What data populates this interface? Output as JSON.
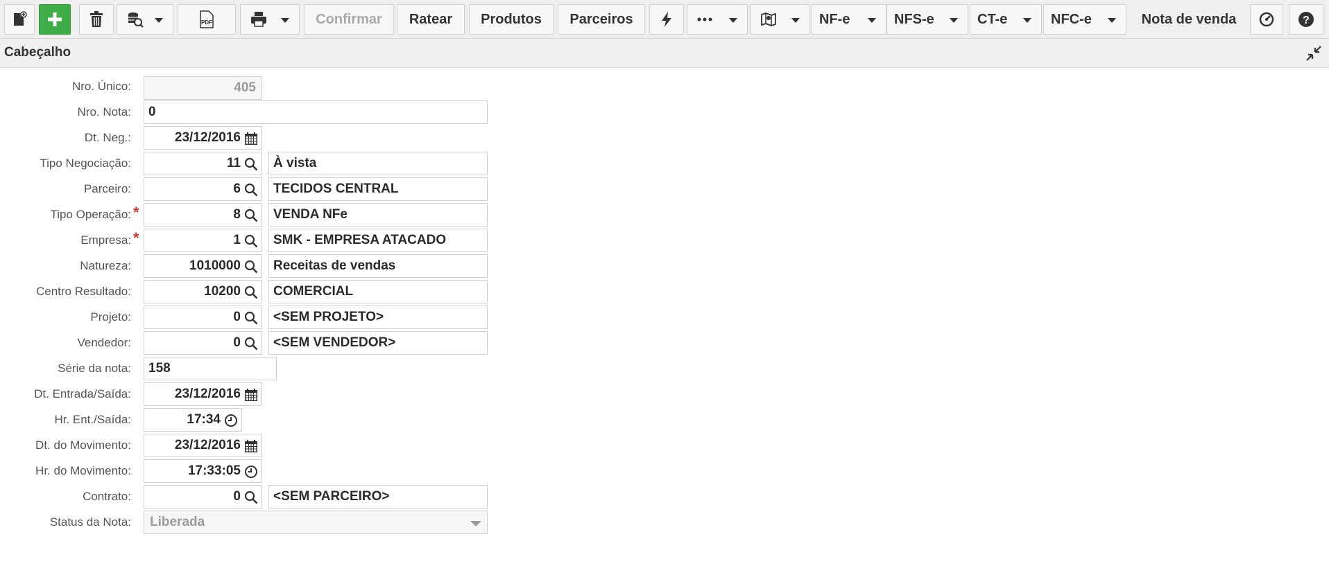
{
  "toolbar": {
    "confirmar_label": "Confirmar",
    "ratear_label": "Ratear",
    "produtos_label": "Produtos",
    "parceiros_label": "Parceiros",
    "nfe_label": "NF-e",
    "nfse_label": "NFS-e",
    "cte_label": "CT-e",
    "nfce_label": "NFC-e",
    "nota_de_venda_label": "Nota de venda",
    "pdf_icon_text": "PDF",
    "colors": {
      "green": "#3fae49",
      "disabled_text": "#a9a9a9"
    }
  },
  "section": {
    "title": "Cabeçalho"
  },
  "form": {
    "nro_unico": {
      "label": "Nro. Único:",
      "value": "405"
    },
    "nro_nota": {
      "label": "Nro. Nota:",
      "value": "0"
    },
    "dt_neg": {
      "label": "Dt. Neg.:",
      "value": "23/12/2016"
    },
    "tipo_negociacao": {
      "label": "Tipo Negociação:",
      "code": "11",
      "description": "À vista"
    },
    "parceiro": {
      "label": "Parceiro:",
      "code": "6",
      "description": "TECIDOS CENTRAL"
    },
    "tipo_operacao": {
      "label": "Tipo Operação:",
      "code": "8",
      "description": "VENDA NFe",
      "required": "*"
    },
    "empresa": {
      "label": "Empresa:",
      "code": "1",
      "description": "SMK - EMPRESA ATACADO",
      "required": "*"
    },
    "natureza": {
      "label": "Natureza:",
      "code": "1010000",
      "description": "Receitas de vendas"
    },
    "centro_resultado": {
      "label": "Centro Resultado:",
      "code": "10200",
      "description": "COMERCIAL"
    },
    "projeto": {
      "label": "Projeto:",
      "code": "0",
      "description": "<SEM PROJETO>"
    },
    "vendedor": {
      "label": "Vendedor:",
      "code": "0",
      "description": "<SEM VENDEDOR>"
    },
    "serie_nota": {
      "label": "Série da nota:",
      "value": "158"
    },
    "dt_entrada_saida": {
      "label": "Dt. Entrada/Saída:",
      "value": "23/12/2016"
    },
    "hr_ent_saida": {
      "label": "Hr. Ent./Saída:",
      "value": "17:34"
    },
    "dt_movimento": {
      "label": "Dt. do Movimento:",
      "value": "23/12/2016"
    },
    "hr_movimento": {
      "label": "Hr. do Movimento:",
      "value": "17:33:05"
    },
    "contrato": {
      "label": "Contrato:",
      "code": "0",
      "description": "<SEM PARCEIRO>"
    },
    "status_nota": {
      "label": "Status da Nota:",
      "value": "Liberada"
    }
  },
  "colors": {
    "required": "#d23b2b",
    "border": "#cfcfcf",
    "readonly_text": "#9a9a9a"
  }
}
